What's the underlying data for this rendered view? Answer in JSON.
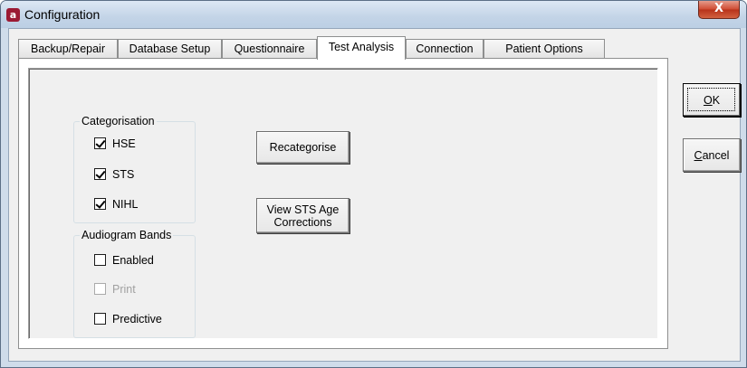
{
  "window": {
    "title": "Configuration",
    "app_icon_glyph": "a",
    "close_glyph": "X",
    "accent": "#9b1a33",
    "close_color": "#c7432a"
  },
  "tabs": [
    {
      "label": "Backup/Repair",
      "active": false
    },
    {
      "label": "Database Setup",
      "active": false
    },
    {
      "label": "Questionnaire",
      "active": false
    },
    {
      "label": "Test Analysis",
      "active": true
    },
    {
      "label": "Connection",
      "active": false
    },
    {
      "label": "Patient Options",
      "active": false
    }
  ],
  "categorisation": {
    "title": "Categorisation",
    "items": [
      {
        "label": "HSE",
        "checked": true
      },
      {
        "label": "STS",
        "checked": true
      },
      {
        "label": "NIHL",
        "checked": true
      }
    ]
  },
  "audiogram_bands": {
    "title": "Audiogram Bands",
    "items": [
      {
        "label": "Enabled",
        "checked": false,
        "disabled": false
      },
      {
        "label": "Print",
        "checked": false,
        "disabled": true
      },
      {
        "label": "Predictive",
        "checked": false,
        "disabled": false
      }
    ]
  },
  "buttons": {
    "recategorise": "Recategorise",
    "view_sts_line1": "View STS Age",
    "view_sts_line2": "Corrections",
    "ok_mnemonic": "O",
    "ok_rest": "K",
    "cancel_mnemonic": "C",
    "cancel_rest": "ancel"
  }
}
